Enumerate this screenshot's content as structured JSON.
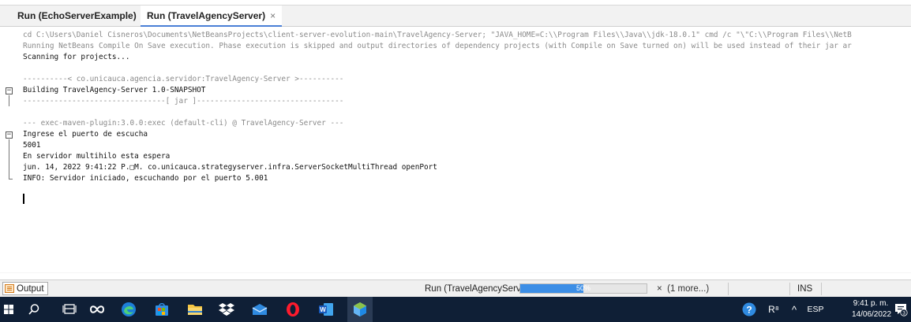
{
  "tabs": [
    {
      "label": "Run (EchoServerExample)",
      "close": "×"
    },
    {
      "label": "Run (TravelAgencyServer)",
      "close": "×"
    }
  ],
  "console": {
    "lines": [
      "cd C:\\Users\\Daniel Cisneros\\Documents\\NetBeansProjects\\client-server-evolution-main\\TravelAgency-Server; \"JAVA_HOME=C:\\\\Program Files\\\\Java\\\\jdk-18.0.1\" cmd /c \"\\\"C:\\\\Program Files\\\\NetB",
      "Running NetBeans Compile On Save execution. Phase execution is skipped and output directories of dependency projects (with Compile on Save turned on) will be used instead of their jar ar",
      "Scanning for projects...",
      "",
      "----------< co.unicauca.agencia.servidor:TravelAgency-Server >----------",
      "Building TravelAgency-Server 1.0-SNAPSHOT",
      "--------------------------------[ jar ]---------------------------------",
      "",
      "--- exec-maven-plugin:3.0.0:exec (default-cli) @ TravelAgency-Server ---",
      "Ingrese el puerto de escucha",
      "5001",
      "En servidor multihilo esta espera",
      "jun. 14, 2022 9:41:22 P.□M. co.unicauca.strategyserver.infra.ServerSocketMultiThread openPort",
      "INFO: Servidor iniciado, escuchando por el puerto 5.001"
    ]
  },
  "status": {
    "output_label": "Output",
    "run_label": "Run (TravelAgencyServer)",
    "progress_text": "50%",
    "progress": 0.5,
    "more_close": "×",
    "more_label": "(1 more...)",
    "ins_label": "INS"
  },
  "taskbar": {
    "lang": "ESP",
    "time": "9:41 p. m.",
    "date": "14/06/2022",
    "notif_count": "3",
    "chevron": "^",
    "account_glyph": "R⁸"
  },
  "colors": {
    "progress_fill": "#3c8ee6",
    "taskbar_bg": "#0f1f36",
    "active_tab_underline": "#4a7fd6"
  }
}
